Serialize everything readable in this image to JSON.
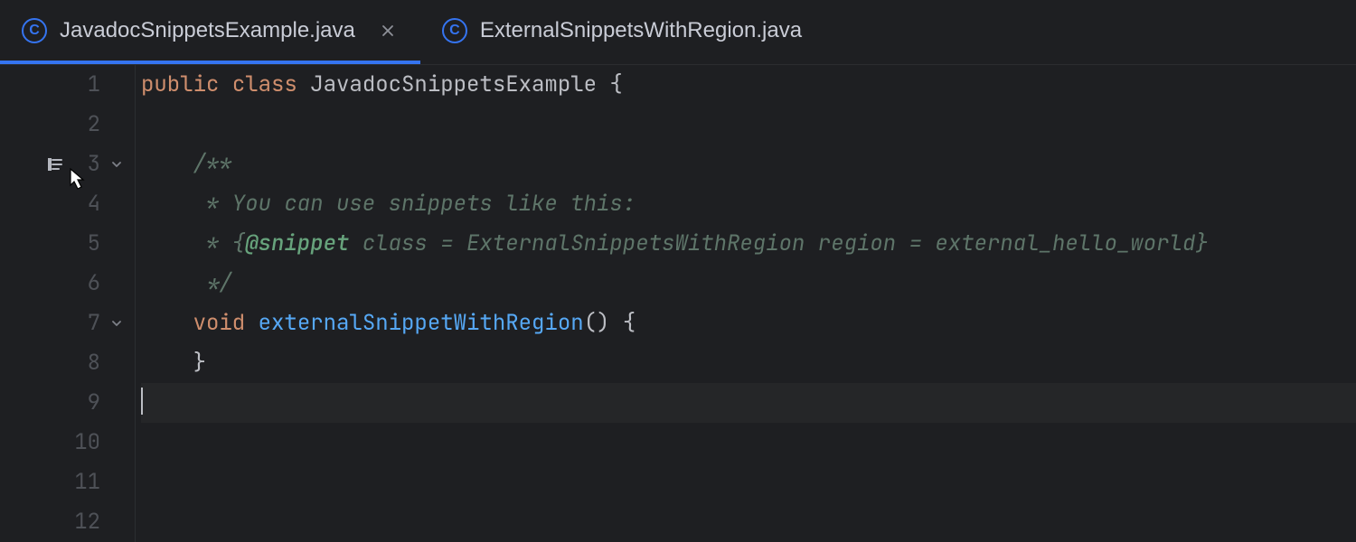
{
  "tabs": [
    {
      "label": "JavadocSnippetsExample.java",
      "active": true,
      "closable": true
    },
    {
      "label": "ExternalSnippetsWithRegion.java",
      "active": false,
      "closable": false
    }
  ],
  "gutter": {
    "lines": [
      "1",
      "2",
      "3",
      "4",
      "5",
      "6",
      "7",
      "8",
      "9",
      "10",
      "11",
      "12"
    ]
  },
  "code": {
    "l1": {
      "kw1": "public",
      "sp1": " ",
      "kw2": "class",
      "sp2": " ",
      "plain": "JavadocSnippetsExample {"
    },
    "l2": "",
    "l3": "    /**",
    "l4": "     * You can use snippets like this:",
    "l5a": "     * {",
    "l5tag": "@snippet",
    "l5b": " class = ExternalSnippetsWithRegion region = external_hello_world}",
    "l6": "     */",
    "l7": {
      "indent": "    ",
      "kw": "void",
      "sp": " ",
      "name": "externalSnippetWithRegion",
      "rest": "() {"
    },
    "l8": "    }",
    "l9": ""
  }
}
